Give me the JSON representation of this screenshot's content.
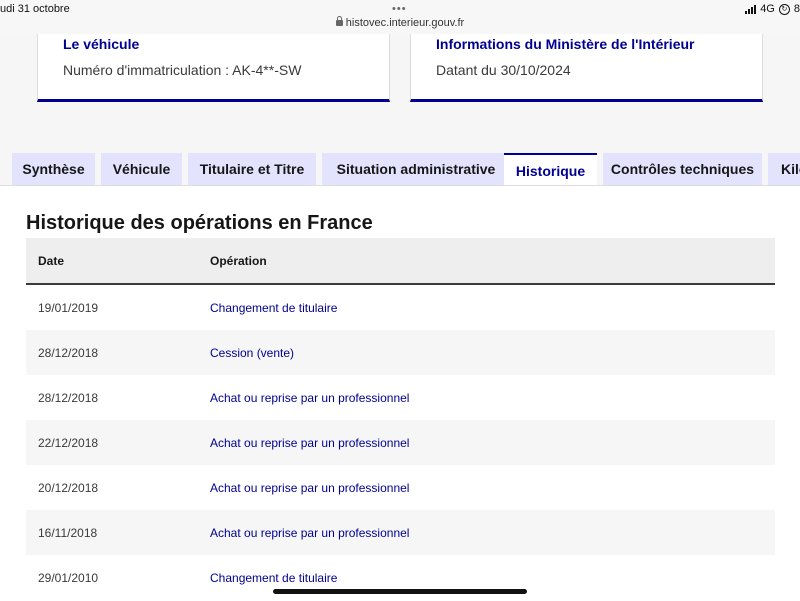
{
  "status_bar": {
    "time": "udi 31 octobre",
    "dots": "•••",
    "url": "histovec.interieur.gouv.fr",
    "network": "4G",
    "battery": "8"
  },
  "cards": [
    {
      "title": "Le véhicule",
      "value": "Numéro d'immatriculation : AK-4**-SW"
    },
    {
      "title": "Informations du Ministère de l'Intérieur",
      "value": "Datant du 30/10/2024"
    }
  ],
  "tabs": [
    {
      "label": "Synthèse"
    },
    {
      "label": "Véhicule"
    },
    {
      "label": "Titulaire et Titre"
    },
    {
      "label": "Situation administrative"
    },
    {
      "label": "Historique",
      "active": true
    },
    {
      "label": "Contrôles techniques"
    },
    {
      "label": "Kilo"
    }
  ],
  "history": {
    "title": "Historique des opérations en France",
    "columns": {
      "date": "Date",
      "operation": "Opération"
    },
    "rows": [
      {
        "date": "19/01/2019",
        "operation": "Changement de titulaire"
      },
      {
        "date": "28/12/2018",
        "operation": "Cession (vente)"
      },
      {
        "date": "28/12/2018",
        "operation": "Achat ou reprise par un professionnel"
      },
      {
        "date": "22/12/2018",
        "operation": "Achat ou reprise par un professionnel"
      },
      {
        "date": "20/12/2018",
        "operation": "Achat ou reprise par un professionnel"
      },
      {
        "date": "16/11/2018",
        "operation": "Achat ou reprise par un professionnel"
      },
      {
        "date": "29/01/2010",
        "operation": "Changement de titulaire"
      }
    ]
  },
  "colors": {
    "accent": "#000091",
    "tab_bg": "#e3e3fd",
    "header_bg": "#eeeeee"
  }
}
